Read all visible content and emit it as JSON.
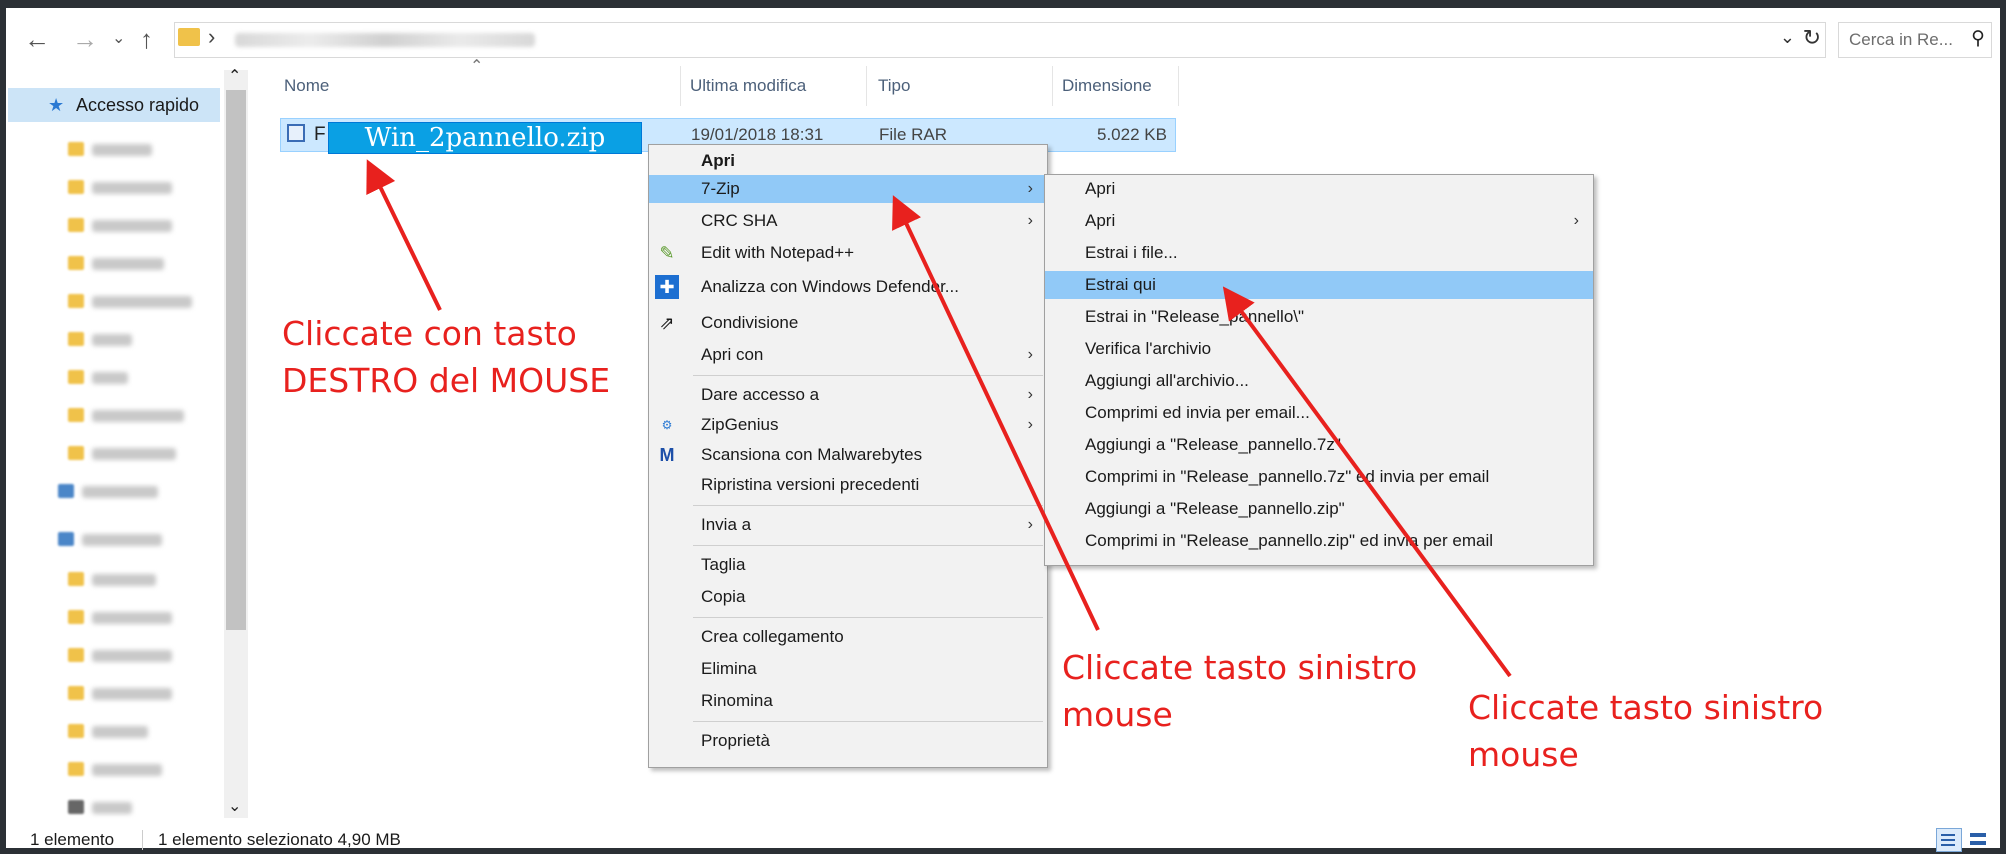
{
  "nav": {
    "back_icon": "arrow-left-icon",
    "forward_icon": "arrow-right-icon",
    "recent_icon": "chevron-down-icon",
    "up_icon": "arrow-up-icon"
  },
  "address": {
    "separator": "›",
    "dropdown": "⌄",
    "refresh": "↻"
  },
  "search": {
    "placeholder": "Cerca in Re...",
    "icon": "⚲"
  },
  "sidebar": {
    "quick_access": "Accesso rapido"
  },
  "columns": {
    "name": "Nome",
    "modified": "Ultima modifica",
    "type": "Tipo",
    "size": "Dimensione"
  },
  "file": {
    "prefix": "F",
    "rename_value": "Win_2pannello.zip",
    "modified": "19/01/2018 18:31",
    "type": "File RAR",
    "size": "5.022 KB"
  },
  "context_menu": {
    "items": [
      {
        "label": "Apri"
      },
      {
        "label": "7-Zip"
      },
      {
        "label": "CRC SHA"
      },
      {
        "label": "Edit with Notepad++"
      },
      {
        "label": "Analizza con Windows Defender..."
      },
      {
        "label": "Condivisione"
      },
      {
        "label": "Apri con"
      },
      {
        "label": "Dare accesso a"
      },
      {
        "label": "ZipGenius"
      },
      {
        "label": "Scansiona con Malwarebytes"
      },
      {
        "label": "Ripristina versioni precedenti"
      },
      {
        "label": "Invia a"
      },
      {
        "label": "Taglia"
      },
      {
        "label": "Copia"
      },
      {
        "label": "Crea collegamento"
      },
      {
        "label": "Elimina"
      },
      {
        "label": "Rinomina"
      },
      {
        "label": "Proprietà"
      }
    ]
  },
  "submenu_7zip": {
    "items": [
      {
        "label": "Apri"
      },
      {
        "label": "Apri"
      },
      {
        "label": "Estrai i file..."
      },
      {
        "label": "Estrai qui"
      },
      {
        "label": "Estrai in \"Release_pannello\\\""
      },
      {
        "label": "Verifica l'archivio"
      },
      {
        "label": "Aggiungi all'archivio..."
      },
      {
        "label": "Comprimi ed invia per email..."
      },
      {
        "label": "Aggiungi a \"Release_pannello.7z\""
      },
      {
        "label": "Comprimi in \"Release_pannello.7z\" ed invia per email"
      },
      {
        "label": "Aggiungi a \"Release_pannello.zip\""
      },
      {
        "label": "Comprimi in \"Release_pannello.zip\" ed invia per email"
      }
    ]
  },
  "annotations": {
    "right_click_line1": "Cliccate con tasto",
    "right_click_line2": "DESTRO del MOUSE",
    "left_click_a_line1": "Cliccate tasto sinistro",
    "left_click_a_line2": "mouse",
    "left_click_b_line1": "Cliccate tasto sinistro",
    "left_click_b_line2": "mouse",
    "arrow_color": "#e8211e"
  },
  "status": {
    "count": "1 elemento",
    "selection": "1 elemento selezionato  4,90 MB"
  },
  "colors": {
    "selection_bg": "#cce8ff",
    "menu_highlight": "#91c9f7",
    "rename_bg": "#0aa0e4"
  }
}
